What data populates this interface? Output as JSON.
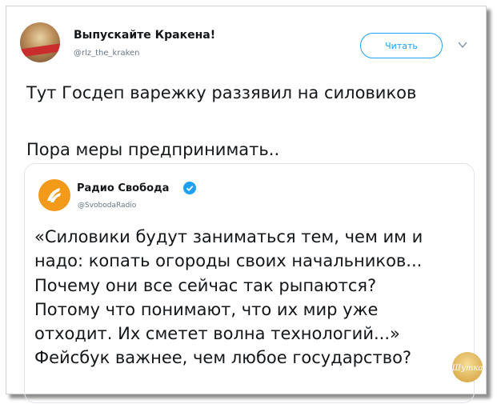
{
  "tweet": {
    "author_name": "Выпускайте Кракена!",
    "author_handle": "@rlz_the_kraken",
    "follow_label": "Читать",
    "text_line1": "Тут Госдеп варежку раззявил на силовиков",
    "text_line2": "Пора меры предпринимать.."
  },
  "quote": {
    "author_name": "Радио Свобода",
    "author_handle": "@SvobodaRadio",
    "lines": [
      "«Силовики будут заниматься тем, чем им и",
      "надо: копать огороды своих начальников...",
      "Почему они все сейчас так рыпаются?",
      "Потому что понимают, что их мир уже",
      "отходит. Их сметет волна технологий...»",
      "Фейсбук важнее, чем любое государство?"
    ]
  },
  "watermark": {
    "text": "Шутка"
  },
  "colors": {
    "accent": "#1da1f2",
    "rs_orange": "#f39a1b",
    "text": "#14171a",
    "muted": "#657786"
  },
  "icons": [
    "chevron-down-icon",
    "verified-icon",
    "radio-svoboda-logo-icon",
    "watermark-badge"
  ]
}
